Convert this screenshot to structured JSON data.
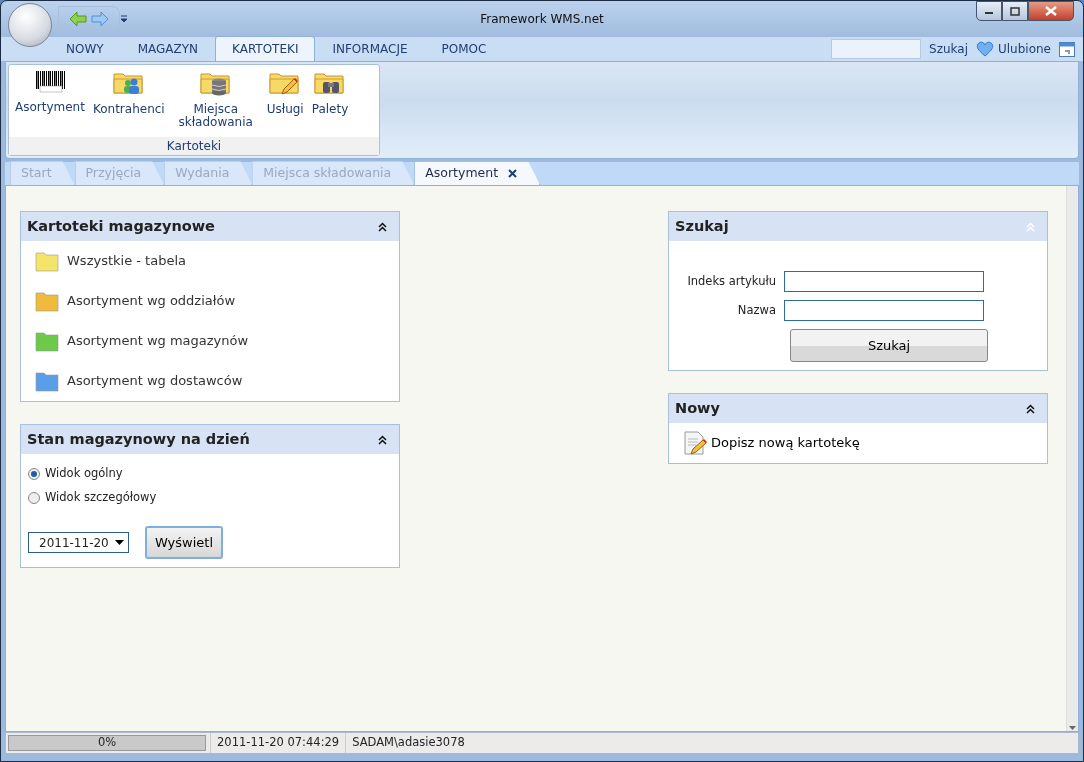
{
  "window": {
    "title": "Framework WMS.net"
  },
  "ribbon": {
    "tabs": [
      {
        "label": "NOWY",
        "selected": false
      },
      {
        "label": "MAGAZYN",
        "selected": false
      },
      {
        "label": "KARTOTEKI",
        "selected": true
      },
      {
        "label": "INFORMACJE",
        "selected": false
      },
      {
        "label": "POMOC",
        "selected": false
      }
    ],
    "search_button": "Szukaj",
    "favorites": "Ulubione",
    "group": {
      "label": "Kartoteki",
      "buttons": [
        {
          "label": "Asortyment",
          "kind": "barcode"
        },
        {
          "label": "Kontrahenci",
          "kind": "people"
        },
        {
          "label": "Miejsca składowania",
          "kind": "database"
        },
        {
          "label": "Usługi",
          "kind": "pencil"
        },
        {
          "label": "Palety",
          "kind": "binoculars"
        }
      ]
    }
  },
  "doc_tabs": [
    {
      "label": "Start",
      "selected": false
    },
    {
      "label": "Przyjęcia",
      "selected": false
    },
    {
      "label": "Wydania",
      "selected": false
    },
    {
      "label": "Miejsca składowania",
      "selected": false
    },
    {
      "label": "Asortyment",
      "selected": true
    }
  ],
  "kartoteki_panel": {
    "title": "Kartoteki magazynowe",
    "items": [
      {
        "label": "Wszystkie  -  tabela",
        "color": "#f5e46a"
      },
      {
        "label": "Asortyment wg oddziałów",
        "color": "#f0bb3c"
      },
      {
        "label": "Asortyment wg magazynów",
        "color": "#6cc94a"
      },
      {
        "label": "Asortyment wg dostawców",
        "color": "#5b9ee8"
      }
    ]
  },
  "stan_panel": {
    "title": "Stan magazynowy na dzień",
    "options": [
      {
        "label": "Widok ogólny",
        "selected": true
      },
      {
        "label": "Widok szczegółowy",
        "selected": false
      }
    ],
    "date": "2011-11-20",
    "button": "Wyświetl"
  },
  "szukaj_panel": {
    "title": "Szukaj",
    "fields": [
      {
        "label": "Indeks artykułu"
      },
      {
        "label": "Nazwa"
      }
    ],
    "button": "Szukaj"
  },
  "nowy_panel": {
    "title": "Nowy",
    "link": "Dopisz nową kartotekę"
  },
  "status_bar": {
    "progress": {
      "level": 0,
      "reading": "0%"
    },
    "datetime": "2011-11-20 07:44:29",
    "user": "SADAM\\adasie3078"
  }
}
